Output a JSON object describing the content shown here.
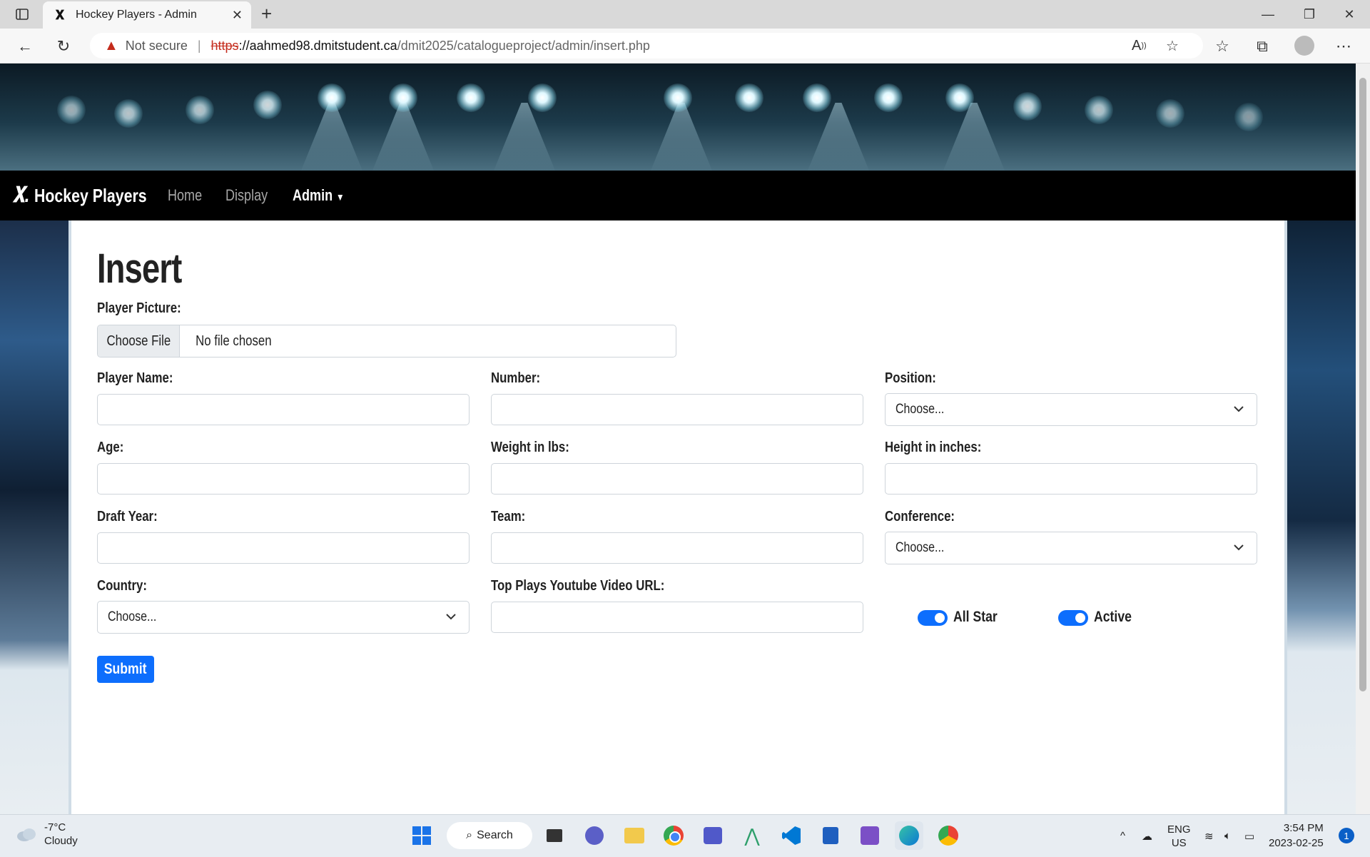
{
  "browser": {
    "tab_title": "Hockey Players - Admin",
    "security_label": "Not secure",
    "url_scheme": "https",
    "url_host": "://aahmed98.dmitstudent.ca",
    "url_path": "/dmit2025/catalogueproject/admin/insert.php"
  },
  "site": {
    "brand": "Hockey Players",
    "nav": {
      "home": "Home",
      "display": "Display",
      "admin": "Admin"
    }
  },
  "form": {
    "title": "Insert",
    "picture_label": "Player Picture:",
    "file_button": "Choose File",
    "file_status": "No file chosen",
    "player_name_label": "Player Name:",
    "number_label": "Number:",
    "position_label": "Position:",
    "position_value": "Choose...",
    "age_label": "Age:",
    "weight_label": "Weight in lbs:",
    "height_label": "Height in inches:",
    "draft_label": "Draft Year:",
    "team_label": "Team:",
    "conference_label": "Conference:",
    "conference_value": "Choose...",
    "country_label": "Country:",
    "country_value": "Choose...",
    "video_label": "Top Plays Youtube Video URL:",
    "allstar_label": "All Star",
    "allstar_on": true,
    "active_label": "Active",
    "active_on": true,
    "submit_label": "Submit"
  },
  "taskbar": {
    "temperature": "-7°C",
    "condition": "Cloudy",
    "search_label": "Search",
    "lang1": "ENG",
    "lang2": "US",
    "time": "3:54 PM",
    "date": "2023-02-25",
    "notification_count": "1"
  },
  "colors": {
    "accent": "#0d6efd",
    "nav_bg": "#000000",
    "warning": "#c42b1c"
  }
}
